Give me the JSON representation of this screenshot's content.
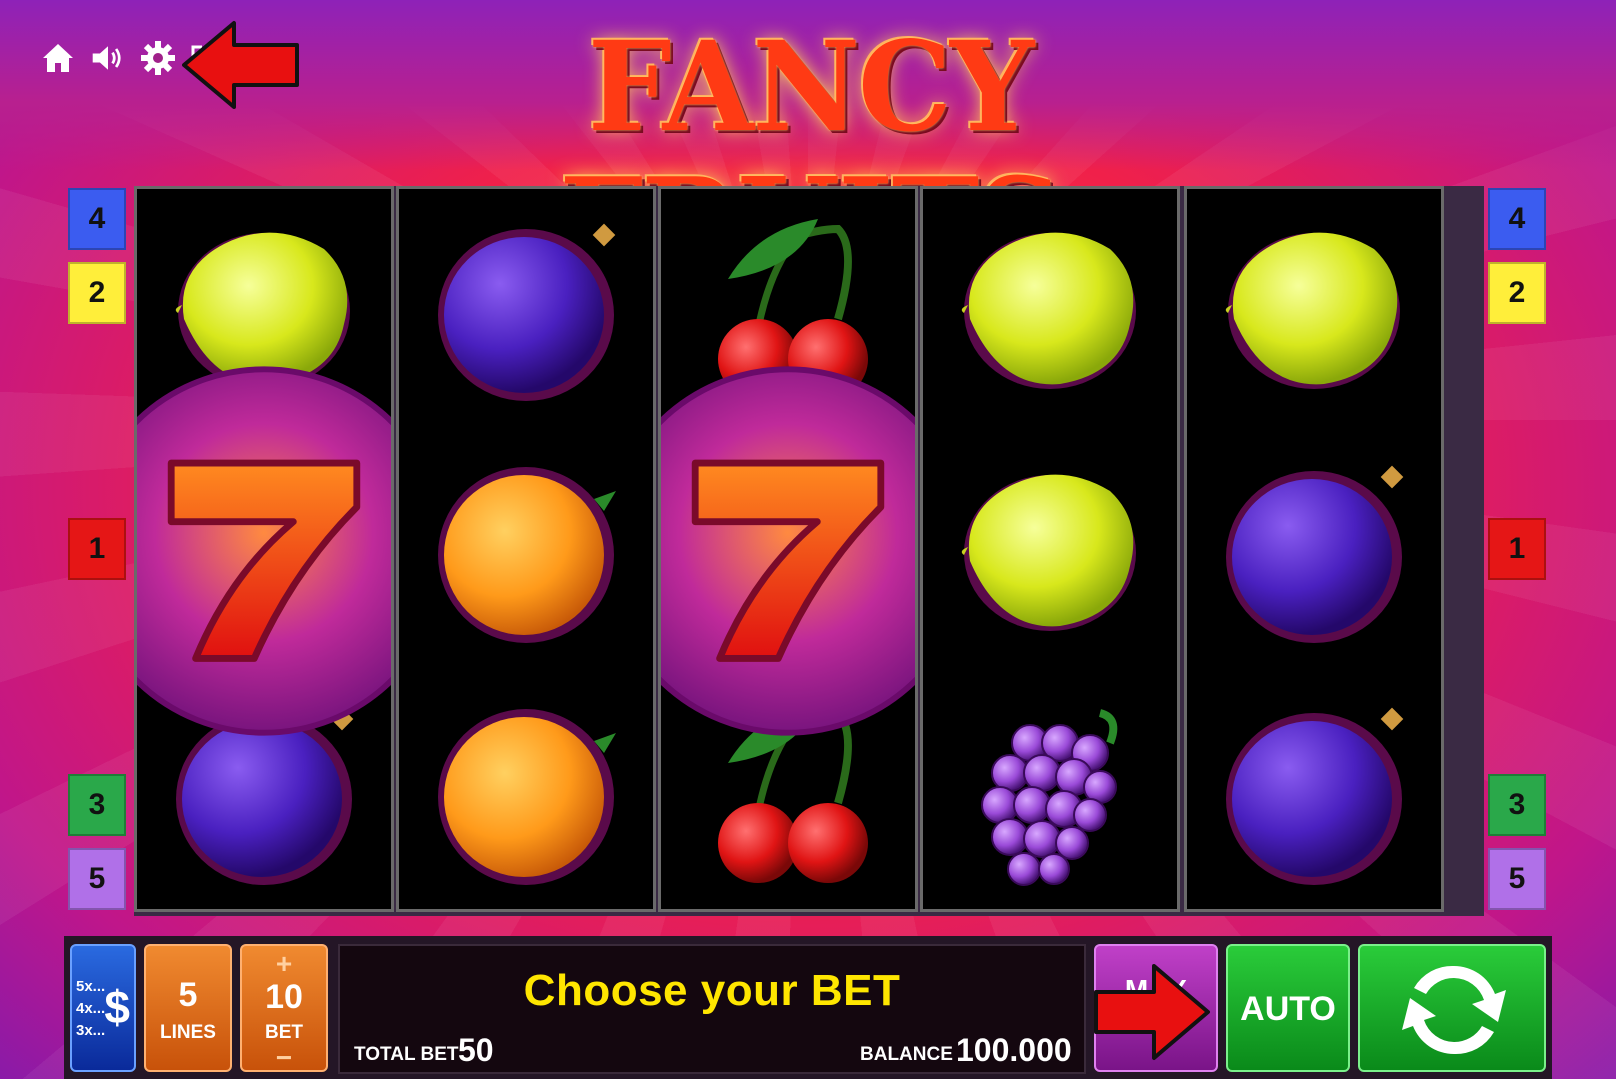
{
  "game": {
    "title": "FANCY FRUITS"
  },
  "top_controls": [
    {
      "name": "home-icon"
    },
    {
      "name": "speaker-icon"
    },
    {
      "name": "gear-icon"
    },
    {
      "name": "fullscreen-icon"
    }
  ],
  "paylines": {
    "left": [
      "4",
      "2",
      "1",
      "3",
      "5"
    ],
    "right": [
      "4",
      "2",
      "1",
      "3",
      "5"
    ]
  },
  "reels": [
    [
      "lemon",
      "seven",
      "plum"
    ],
    [
      "plum",
      "orange",
      "orange"
    ],
    [
      "cherry",
      "seven",
      "cherry"
    ],
    [
      "lemon",
      "lemon",
      "grapes"
    ],
    [
      "lemon",
      "plum",
      "plum"
    ]
  ],
  "controls": {
    "gamble": {
      "lines": [
        "5x...",
        "4x...",
        "3x..."
      ],
      "symbol": "$"
    },
    "lines": {
      "value": "5",
      "label": "LINES"
    },
    "bet": {
      "plus": "+",
      "value": "10",
      "label": "BET",
      "minus": "−"
    },
    "message": "Choose your BET",
    "total_bet_label": "TOTAL BET",
    "total_bet_value": "50",
    "balance_label": "BALANCE",
    "balance_value": "100.000",
    "max_label": "MAX",
    "auto_label": "AUTO"
  },
  "colors": {
    "accent_yellow": "#ffe600",
    "auto_green": "#12a82a",
    "bet_orange": "#e8701a",
    "max_purple": "#a028b0"
  }
}
